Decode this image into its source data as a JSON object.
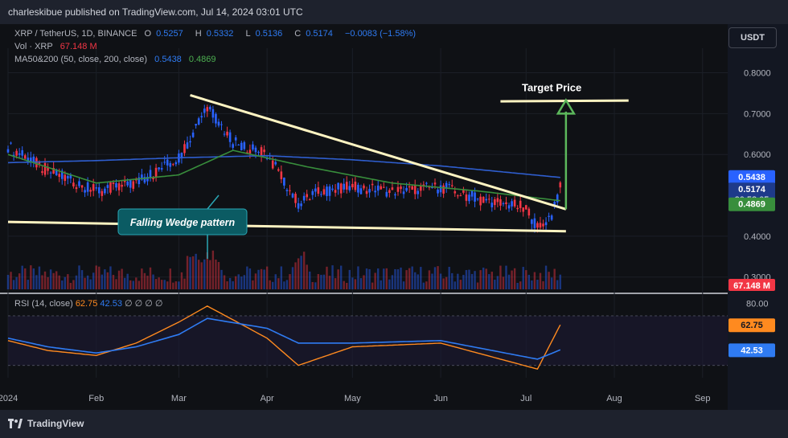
{
  "header": {
    "text": "charleskibue published on TradingView.com, Jul 14, 2024 03:01 UTC"
  },
  "legend": {
    "symbol": "XRP / TetherUS, 1D, BINANCE",
    "open_label": "O",
    "open": "0.5257",
    "high_label": "H",
    "high": "0.5332",
    "low_label": "L",
    "low": "0.5136",
    "close_label": "C",
    "close": "0.5174",
    "change": "−0.0083 (−1.58%)",
    "vol_label": "Vol · XRP",
    "vol_value": "67.148 M",
    "ma_label": "MA50&200 (50, close, 200, close)",
    "ma50": "0.5438",
    "ma200": "0.4869",
    "rsi_label": "RSI (14, close)",
    "rsi_value": "62.75",
    "rsi_ma": "42.53",
    "rsi_extra": "∅  ∅  ∅  ∅"
  },
  "toolbar": {
    "currency": "USDT"
  },
  "colors": {
    "up": "#2962ff",
    "down": "#f23645",
    "ma50": "#2f5ecf",
    "ma200": "#388e3c",
    "wedge": "#fff4c2",
    "arrow": "#5cb85c",
    "rsi": "#ff8a1f",
    "rsi_ma": "#2f7bf2",
    "pill_bg": "#0b5b63",
    "pill_border": "#2aa7b5"
  },
  "annotations": {
    "target": "Target Price",
    "pattern": "Falling Wedge pattern"
  },
  "price_badges": {
    "ma50": "0.5438",
    "last": "0.5174",
    "countdown": "20:58:05",
    "ma200": "0.4869",
    "volume": "67.148 M",
    "rsi": "62.75",
    "rsi_ma": "42.53"
  },
  "footer": {
    "brand": "TradingView"
  },
  "chart_data": {
    "type": "line",
    "title": "XRP / TetherUS, 1D, BINANCE",
    "xlabel": "",
    "ylabel": "",
    "x_ticks": [
      "2024",
      "Feb",
      "Mar",
      "Apr",
      "May",
      "Jun",
      "Jul",
      "Aug",
      "Sep"
    ],
    "y_ticks": [
      "0.8000",
      "0.7000",
      "0.6000",
      "0.4000",
      "0.3000"
    ],
    "ylim": [
      0.27,
      0.86
    ],
    "series": [
      {
        "name": "XRP",
        "x": [
          "Jan 1",
          "Jan 15",
          "Feb 1",
          "Feb 15",
          "Mar 1",
          "Mar 11",
          "Mar 20",
          "Apr 1",
          "Apr 12",
          "Apr 20",
          "May 1",
          "May 15",
          "Jun 1",
          "Jun 15",
          "Jul 1",
          "Jul 5",
          "Jul 10",
          "Jul 13"
        ],
        "values": [
          0.62,
          0.56,
          0.51,
          0.53,
          0.59,
          0.72,
          0.63,
          0.6,
          0.48,
          0.51,
          0.52,
          0.51,
          0.52,
          0.49,
          0.47,
          0.42,
          0.45,
          0.5174
        ]
      },
      {
        "name": "MA50",
        "x": [
          "Jan 1",
          "Feb 1",
          "Mar 1",
          "Mar 20",
          "Apr 15",
          "May 15",
          "Jun 15",
          "Jul 13"
        ],
        "values": [
          0.6,
          0.53,
          0.55,
          0.61,
          0.57,
          0.53,
          0.51,
          0.4869
        ]
      },
      {
        "name": "MA200",
        "x": [
          "Jan 1",
          "Feb 1",
          "Mar 1",
          "Apr 1",
          "May 1",
          "Jun 1",
          "Jul 13"
        ],
        "values": [
          0.58,
          0.585,
          0.592,
          0.597,
          0.587,
          0.572,
          0.5438
        ]
      }
    ],
    "volume": {
      "last": "67.148 M"
    },
    "rsi": {
      "y_tick": "80.00",
      "ylim": [
        20,
        85
      ],
      "x": [
        "Jan 1",
        "Jan 15",
        "Feb 1",
        "Feb 15",
        "Mar 1",
        "Mar 11",
        "Apr 1",
        "Apr 12",
        "May 1",
        "Jun 1",
        "Jul 5",
        "Jul 13"
      ],
      "values": [
        50,
        42,
        38,
        48,
        65,
        78,
        52,
        30,
        45,
        48,
        27,
        62.75
      ],
      "ma": [
        52,
        45,
        40,
        45,
        55,
        68,
        60,
        48,
        48,
        50,
        35,
        42.53
      ]
    },
    "annotations": [
      "Target Price",
      "Falling Wedge pattern"
    ]
  }
}
